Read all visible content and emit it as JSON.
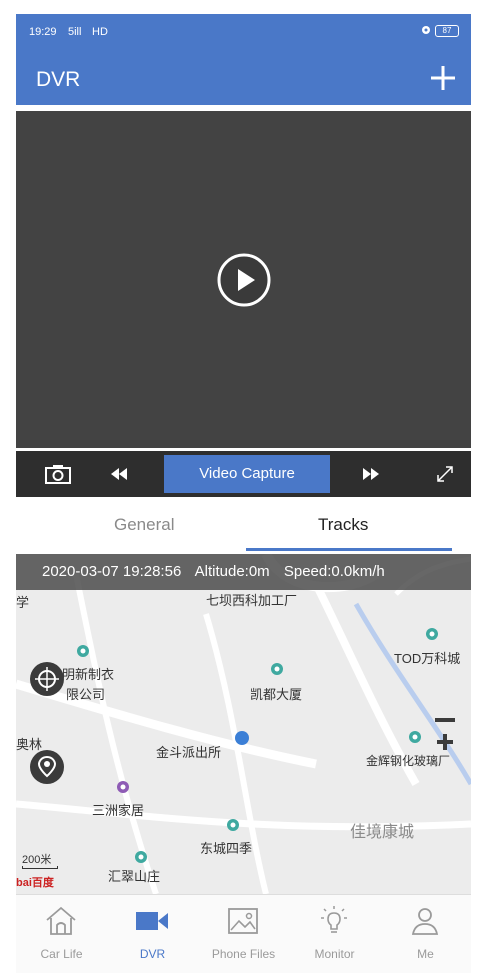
{
  "status_bar": {
    "time": "19:29",
    "signal_text": "5ill",
    "network": "HD",
    "battery": "87"
  },
  "app_bar": {
    "title": "DVR",
    "add_icon": "plus-icon"
  },
  "video": {
    "play_icon": "play-icon"
  },
  "controls": {
    "camera_icon": "camera-icon",
    "rewind_icon": "rewind-icon",
    "capture_label": "Video Capture",
    "forward_icon": "fast-forward-icon",
    "fullscreen_icon": "fullscreen-icon"
  },
  "tabs": {
    "general": "General",
    "tracks": "Tracks"
  },
  "map": {
    "info": {
      "datetime": "2020-03-07 19:28:56",
      "altitude": "Altitude:0m",
      "speed": "Speed:0.0km/h"
    },
    "labels": {
      "l1": "七坝西科加工厂",
      "l2": "中山明新制衣",
      "l3": "限公司",
      "l4": "TOD万科城",
      "l5": "凯都大厦",
      "l6": "金斗派出所",
      "l7": "金辉钢化玻璃厂",
      "l8": "三洲家居",
      "l9": "佳境康城",
      "l10": "东城四季",
      "l11": "汇翠山庄",
      "l12": "学",
      "l13": "奥林"
    },
    "scale": "200米",
    "baidu": "bai百度",
    "colors": {
      "road": "#b9cdee",
      "poi": "#3fa9a0",
      "poi_purple": "#8e5bb5",
      "location": "#3b7fd6"
    }
  },
  "bottom_nav": [
    {
      "label": "Car Life",
      "icon": "home-icon",
      "active": false
    },
    {
      "label": "DVR",
      "icon": "video-camera-icon",
      "active": true
    },
    {
      "label": "Phone Files",
      "icon": "image-icon",
      "active": false
    },
    {
      "label": "Monitor",
      "icon": "bulb-icon",
      "active": false
    },
    {
      "label": "Me",
      "icon": "person-icon",
      "active": false
    }
  ],
  "colors": {
    "primary": "#4a78c8",
    "video_bg": "#434343",
    "controls_bg": "#2e2e2e"
  }
}
